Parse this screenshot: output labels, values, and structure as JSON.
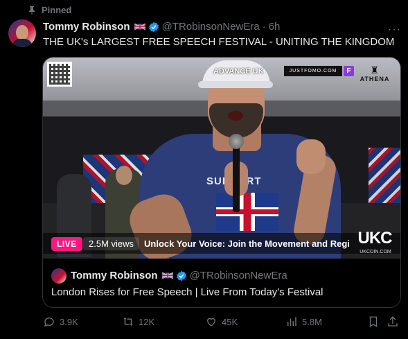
{
  "pinned": {
    "label": "Pinned"
  },
  "author": {
    "name": "Tommy Robinson",
    "handle": "@TRobinsonNewEra",
    "time": "6h",
    "separator": "·"
  },
  "tweet": {
    "text": "THE UK's LARGEST FREE SPEECH FESTIVAL - UNITING THE KINGDOM"
  },
  "video": {
    "live_label": "LIVE",
    "views": "2.5M views",
    "ticker": "Unlock Your Voice: Join the Movement and Regis",
    "overlay_sponsors": {
      "advance": "ADVANCE UK",
      "justfomo": "JUSTFOMO.COM",
      "athena": "ATHENA",
      "ukc": "UKC",
      "ukc_sub": "UKCOIN.COM"
    },
    "banner_text": "SUPPORT"
  },
  "quote": {
    "name": "Tommy Robinson",
    "handle": "@TRobinsonNewEra",
    "text": "London Rises for Free Speech | Live From Today's Festival"
  },
  "actions": {
    "replies": "3.9K",
    "reposts": "12K",
    "likes": "45K",
    "views": "5.8M"
  },
  "colors": {
    "background": "#000000",
    "text": "#e7e9ea",
    "muted": "#71767b",
    "verified": "#1d9bf0",
    "live": "#f91880"
  }
}
